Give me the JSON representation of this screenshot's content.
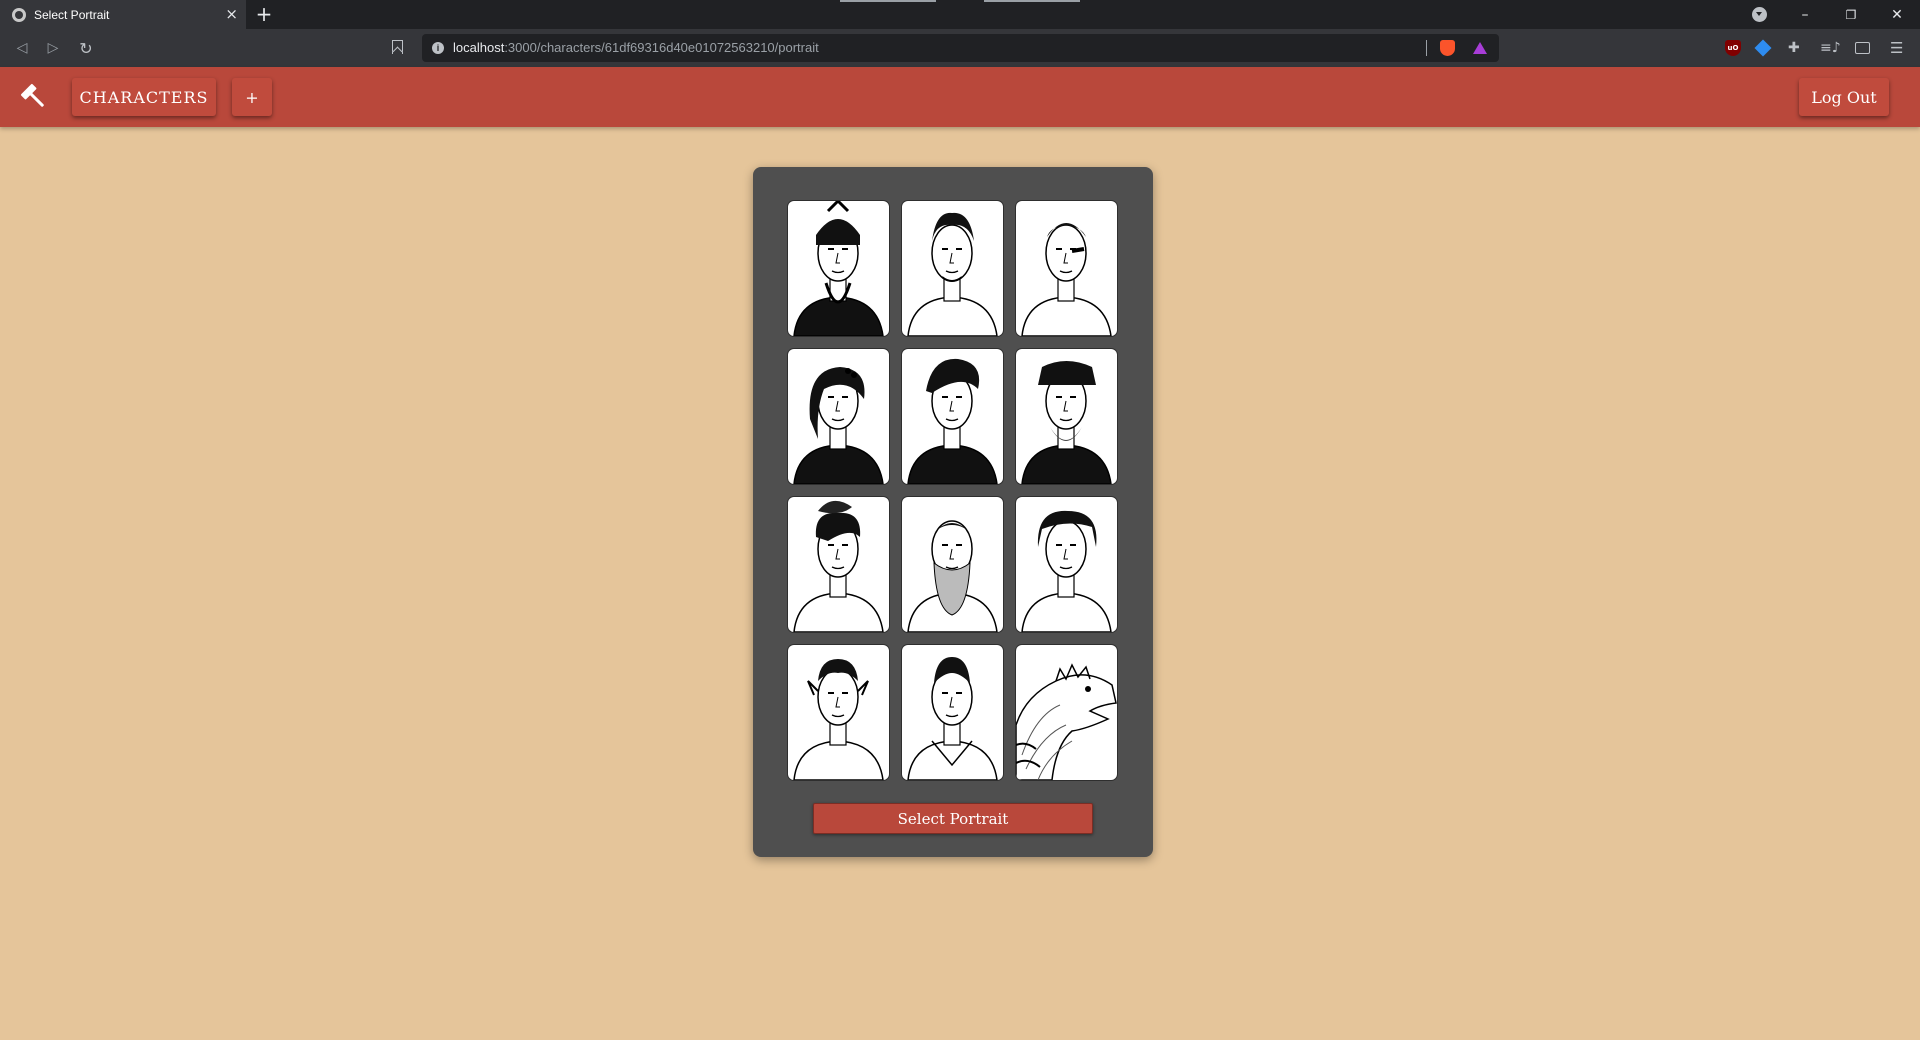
{
  "browser": {
    "tab_title": "Select Portrait",
    "tab_close": "×",
    "new_tab": "+",
    "url_host": "localhost",
    "url_rest": ":3000/characters/61df69316d40e01072563210/portrait",
    "controls": {
      "minimize": "–",
      "restore": "❐",
      "close": "✕"
    },
    "nav": {
      "back": "◁",
      "forward": "▷",
      "reload": "↻"
    },
    "extensions": {
      "ublock": "uO",
      "puzzle": "✚",
      "list": "≡♪",
      "menu": "☰"
    }
  },
  "app_nav": {
    "characters_label": "CHARACTERS",
    "add_label": "+",
    "logout_label": "Log Out",
    "accent": "#b9483b"
  },
  "portrait_panel": {
    "select_label": "Select Portrait",
    "portraits": [
      {
        "name": "armored-samurai",
        "icon": "samurai-portrait-icon"
      },
      {
        "name": "curly-haired-man",
        "icon": "man-portrait-icon"
      },
      {
        "name": "bald-man-eyepatch",
        "icon": "man-portrait-icon"
      },
      {
        "name": "woman-hair-pins",
        "icon": "woman-portrait-icon"
      },
      {
        "name": "woman-beret",
        "icon": "woman-portrait-icon"
      },
      {
        "name": "captain-cap-bearded",
        "icon": "man-portrait-icon"
      },
      {
        "name": "woman-feather-hat",
        "icon": "woman-portrait-icon"
      },
      {
        "name": "bearded-old-man",
        "icon": "man-portrait-icon"
      },
      {
        "name": "heavyset-woman-bangs",
        "icon": "woman-portrait-icon"
      },
      {
        "name": "pointy-eared-man",
        "icon": "man-portrait-icon"
      },
      {
        "name": "elf-woman-armor",
        "icon": "woman-portrait-icon"
      },
      {
        "name": "lizard-creature",
        "icon": "lizard-portrait-icon"
      }
    ]
  },
  "colors": {
    "page_background": "#e5c59a",
    "panel_background": "#4f4f4f",
    "nav_background": "#b9483b"
  }
}
